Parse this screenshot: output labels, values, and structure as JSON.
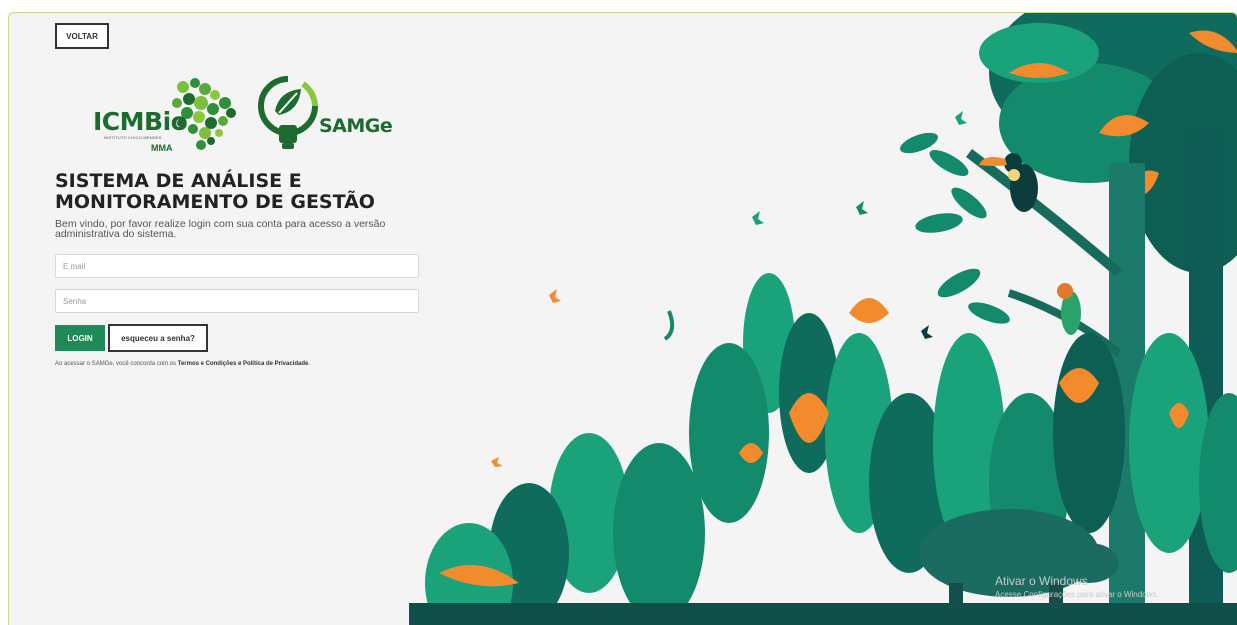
{
  "header": {
    "back_label": "VOLTAR"
  },
  "logos": {
    "icmbio": {
      "name": "ICMBio",
      "subtitle": "INSTITUTO CHICO MENDES",
      "ministry": "MMA"
    },
    "samge": {
      "name": "SAMGe"
    }
  },
  "login": {
    "title": "SISTEMA DE ANÁLISE E MONITORAMENTO DE GESTÃO",
    "subtitle": "Bem vindo, por favor realize login com sua conta para acesso a versão administrativa do sistema.",
    "email_placeholder": "E mail",
    "password_placeholder": "Senha",
    "login_label": "LOGIN",
    "forgot_label": "esqueceu a senha?",
    "terms_prefix": "Ao acessar o SAMGe, você concorda com os",
    "terms_link": "Termos e Condições e Política de Privacidade",
    "terms_suffix": "."
  },
  "watermark": {
    "line1": "Ativar o Windows",
    "line2": "Acesse Configurações para ativar o Windows."
  },
  "colors": {
    "brand_green": "#1d6b2e",
    "button_green": "#1f8a58",
    "accent_orange": "#f28a2e",
    "teal": "#1a9a7a"
  }
}
